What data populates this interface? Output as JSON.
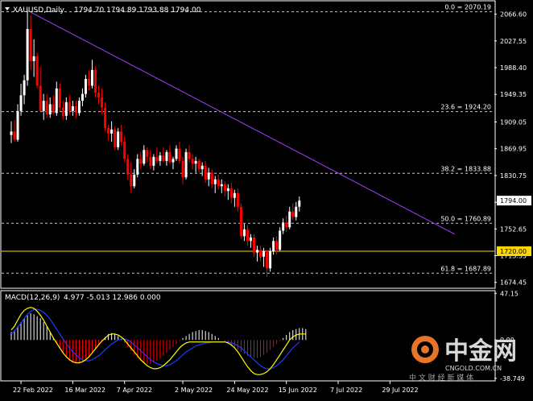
{
  "header": {
    "symbol": "XAUUSD,Daily",
    "ohlc": "1794.70 1794.89 1793.88 1794.00",
    "symbol_icon": "chevron-down-icon"
  },
  "macd_header": {
    "label": "MACD(12,26,9)",
    "values": "4.977 -5.013 12.986 0.000"
  },
  "watermark": {
    "logo_text": "中金网",
    "domain": "CNGOLD.COM.CN",
    "slogan": "中 文 财 经 新 媒 体",
    "logo_icon": "coin-icon"
  },
  "colors": {
    "background": "#000000",
    "bull": "#ffffff",
    "bear": "#ff0000",
    "trendline": "#a040ff",
    "fibo": "#c8c8c8",
    "support_line": "#ffd700",
    "macd_hist_pos": "#ffffff",
    "macd_hist_neg": "#ff0000",
    "macd_line": "#ffff00",
    "signal_line": "#1a3cff"
  },
  "chart_data": {
    "type": "candlestick",
    "symbol": "XAUUSD",
    "timeframe": "Daily",
    "price_ylim": [
      1667,
      2085
    ],
    "y_ticks": [
      "2066.60",
      "2027.55",
      "1988.40",
      "1949.35",
      "1909.05",
      "1869.95",
      "1830.75",
      "1791.65",
      "1752.65",
      "1713.55",
      "1674.45"
    ],
    "x_tick_labels": [
      "22 Feb 2022",
      "16 Mar 2022",
      "7 Apr 2022",
      "2 May 2022",
      "24 May 2022",
      "15 Jun 2022",
      "7 Jul 2022",
      "29 Jul 2022"
    ],
    "x_tick_index": [
      3,
      19,
      35,
      53,
      69,
      85,
      101,
      117
    ],
    "candles": [
      {
        "o": 1890,
        "h": 1910,
        "l": 1878,
        "c": 1895
      },
      {
        "o": 1895,
        "h": 1912,
        "l": 1880,
        "c": 1883
      },
      {
        "o": 1883,
        "h": 1935,
        "l": 1880,
        "c": 1925
      },
      {
        "o": 1925,
        "h": 1965,
        "l": 1918,
        "c": 1948
      },
      {
        "o": 1948,
        "h": 1978,
        "l": 1935,
        "c": 1970
      },
      {
        "o": 1970,
        "h": 2070,
        "l": 1962,
        "c": 2045
      },
      {
        "o": 2045,
        "h": 2065,
        "l": 1985,
        "c": 1998
      },
      {
        "o": 1998,
        "h": 2030,
        "l": 1975,
        "c": 2005
      },
      {
        "o": 2005,
        "h": 2010,
        "l": 1958,
        "c": 1962
      },
      {
        "o": 1962,
        "h": 1990,
        "l": 1938,
        "c": 1925
      },
      {
        "o": 1925,
        "h": 1950,
        "l": 1912,
        "c": 1940
      },
      {
        "o": 1940,
        "h": 1950,
        "l": 1915,
        "c": 1920
      },
      {
        "o": 1920,
        "h": 1945,
        "l": 1915,
        "c": 1935
      },
      {
        "o": 1935,
        "h": 1948,
        "l": 1920,
        "c": 1922
      },
      {
        "o": 1922,
        "h": 1968,
        "l": 1918,
        "c": 1958
      },
      {
        "o": 1958,
        "h": 1965,
        "l": 1925,
        "c": 1930
      },
      {
        "o": 1930,
        "h": 1940,
        "l": 1912,
        "c": 1918
      },
      {
        "o": 1918,
        "h": 1945,
        "l": 1912,
        "c": 1938
      },
      {
        "o": 1938,
        "h": 1948,
        "l": 1920,
        "c": 1925
      },
      {
        "o": 1925,
        "h": 1940,
        "l": 1918,
        "c": 1932
      },
      {
        "o": 1932,
        "h": 1940,
        "l": 1915,
        "c": 1922
      },
      {
        "o": 1922,
        "h": 1945,
        "l": 1918,
        "c": 1940
      },
      {
        "o": 1940,
        "h": 1958,
        "l": 1932,
        "c": 1950
      },
      {
        "o": 1950,
        "h": 1978,
        "l": 1945,
        "c": 1972
      },
      {
        "o": 1972,
        "h": 1985,
        "l": 1955,
        "c": 1962
      },
      {
        "o": 1962,
        "h": 2000,
        "l": 1958,
        "c": 1985
      },
      {
        "o": 1985,
        "h": 1990,
        "l": 1945,
        "c": 1952
      },
      {
        "o": 1952,
        "h": 1962,
        "l": 1935,
        "c": 1945
      },
      {
        "o": 1945,
        "h": 1958,
        "l": 1920,
        "c": 1930
      },
      {
        "o": 1930,
        "h": 1938,
        "l": 1895,
        "c": 1900
      },
      {
        "o": 1900,
        "h": 1905,
        "l": 1882,
        "c": 1892
      },
      {
        "o": 1892,
        "h": 1910,
        "l": 1880,
        "c": 1898
      },
      {
        "o": 1898,
        "h": 1902,
        "l": 1868,
        "c": 1872
      },
      {
        "o": 1872,
        "h": 1900,
        "l": 1868,
        "c": 1895
      },
      {
        "o": 1895,
        "h": 1905,
        "l": 1875,
        "c": 1880
      },
      {
        "o": 1880,
        "h": 1888,
        "l": 1850,
        "c": 1855
      },
      {
        "o": 1855,
        "h": 1862,
        "l": 1825,
        "c": 1832
      },
      {
        "o": 1832,
        "h": 1850,
        "l": 1805,
        "c": 1815
      },
      {
        "o": 1815,
        "h": 1840,
        "l": 1812,
        "c": 1832
      },
      {
        "o": 1832,
        "h": 1862,
        "l": 1828,
        "c": 1855
      },
      {
        "o": 1855,
        "h": 1865,
        "l": 1840,
        "c": 1848
      },
      {
        "o": 1848,
        "h": 1875,
        "l": 1845,
        "c": 1868
      },
      {
        "o": 1868,
        "h": 1872,
        "l": 1850,
        "c": 1858
      },
      {
        "o": 1858,
        "h": 1868,
        "l": 1840,
        "c": 1845
      },
      {
        "o": 1845,
        "h": 1862,
        "l": 1838,
        "c": 1858
      },
      {
        "o": 1858,
        "h": 1872,
        "l": 1848,
        "c": 1852
      },
      {
        "o": 1852,
        "h": 1865,
        "l": 1845,
        "c": 1860
      },
      {
        "o": 1860,
        "h": 1872,
        "l": 1850,
        "c": 1852
      },
      {
        "o": 1852,
        "h": 1868,
        "l": 1845,
        "c": 1865
      },
      {
        "o": 1865,
        "h": 1875,
        "l": 1848,
        "c": 1850
      },
      {
        "o": 1850,
        "h": 1858,
        "l": 1840,
        "c": 1855
      },
      {
        "o": 1855,
        "h": 1875,
        "l": 1852,
        "c": 1870
      },
      {
        "o": 1870,
        "h": 1880,
        "l": 1848,
        "c": 1852
      },
      {
        "o": 1852,
        "h": 1858,
        "l": 1818,
        "c": 1828
      },
      {
        "o": 1828,
        "h": 1870,
        "l": 1825,
        "c": 1865
      },
      {
        "o": 1865,
        "h": 1875,
        "l": 1850,
        "c": 1855
      },
      {
        "o": 1855,
        "h": 1862,
        "l": 1840,
        "c": 1848
      },
      {
        "o": 1848,
        "h": 1858,
        "l": 1835,
        "c": 1852
      },
      {
        "o": 1852,
        "h": 1855,
        "l": 1835,
        "c": 1840
      },
      {
        "o": 1840,
        "h": 1850,
        "l": 1830,
        "c": 1845
      },
      {
        "o": 1845,
        "h": 1852,
        "l": 1820,
        "c": 1825
      },
      {
        "o": 1825,
        "h": 1842,
        "l": 1815,
        "c": 1835
      },
      {
        "o": 1835,
        "h": 1840,
        "l": 1812,
        "c": 1818
      },
      {
        "o": 1818,
        "h": 1830,
        "l": 1805,
        "c": 1825
      },
      {
        "o": 1825,
        "h": 1832,
        "l": 1810,
        "c": 1815
      },
      {
        "o": 1815,
        "h": 1825,
        "l": 1805,
        "c": 1818
      },
      {
        "o": 1818,
        "h": 1822,
        "l": 1800,
        "c": 1808
      },
      {
        "o": 1808,
        "h": 1818,
        "l": 1795,
        "c": 1812
      },
      {
        "o": 1812,
        "h": 1820,
        "l": 1790,
        "c": 1798
      },
      {
        "o": 1798,
        "h": 1810,
        "l": 1785,
        "c": 1805
      },
      {
        "o": 1805,
        "h": 1812,
        "l": 1778,
        "c": 1785
      },
      {
        "o": 1785,
        "h": 1790,
        "l": 1738,
        "c": 1742
      },
      {
        "o": 1742,
        "h": 1760,
        "l": 1735,
        "c": 1752
      },
      {
        "o": 1752,
        "h": 1758,
        "l": 1728,
        "c": 1735
      },
      {
        "o": 1735,
        "h": 1745,
        "l": 1725,
        "c": 1740
      },
      {
        "o": 1740,
        "h": 1745,
        "l": 1712,
        "c": 1718
      },
      {
        "o": 1718,
        "h": 1728,
        "l": 1705,
        "c": 1722
      },
      {
        "o": 1722,
        "h": 1728,
        "l": 1705,
        "c": 1712
      },
      {
        "o": 1712,
        "h": 1725,
        "l": 1697,
        "c": 1720
      },
      {
        "o": 1720,
        "h": 1722,
        "l": 1682,
        "c": 1695
      },
      {
        "o": 1695,
        "h": 1725,
        "l": 1690,
        "c": 1720
      },
      {
        "o": 1720,
        "h": 1740,
        "l": 1715,
        "c": 1735
      },
      {
        "o": 1735,
        "h": 1742,
        "l": 1715,
        "c": 1722
      },
      {
        "o": 1722,
        "h": 1755,
        "l": 1720,
        "c": 1750
      },
      {
        "o": 1750,
        "h": 1768,
        "l": 1745,
        "c": 1762
      },
      {
        "o": 1762,
        "h": 1772,
        "l": 1748,
        "c": 1755
      },
      {
        "o": 1755,
        "h": 1785,
        "l": 1752,
        "c": 1778
      },
      {
        "o": 1778,
        "h": 1790,
        "l": 1765,
        "c": 1770
      },
      {
        "o": 1770,
        "h": 1792,
        "l": 1765,
        "c": 1785
      },
      {
        "o": 1785,
        "h": 1800,
        "l": 1778,
        "c": 1794
      }
    ],
    "candle_index_offset": 0,
    "fibonacci": {
      "levels": [
        {
          "label": "0.0 = 2070.19",
          "price": 2070.19
        },
        {
          "label": "23.6 = 1924.20",
          "price": 1924.2
        },
        {
          "label": "38.2 = 1833.88",
          "price": 1833.88
        },
        {
          "label": "50.0 = 1760.89",
          "price": 1760.89
        },
        {
          "label": "61.8 = 1687.89",
          "price": 1687.89
        }
      ]
    },
    "current_price_label": "1794.00",
    "support_level": {
      "label": "1720.00",
      "price": 1720.0
    },
    "trendline": {
      "start": {
        "index": 5,
        "price": 2072
      },
      "end": {
        "index": 137,
        "price": 1745
      }
    },
    "macd": {
      "ylim": [
        -40.5,
        49
      ],
      "y_ticks": [
        "47.15",
        "0.00",
        "-38.749"
      ],
      "histogram": [
        8,
        10,
        14,
        18,
        22,
        25,
        27,
        26,
        24,
        22,
        18,
        14,
        8,
        2,
        -4,
        -9,
        -14,
        -18,
        -21,
        -23,
        -24,
        -24,
        -22,
        -20,
        -17,
        -13,
        -9,
        -5,
        -1,
        3,
        6,
        7,
        6,
        4,
        1,
        -3,
        -7,
        -11,
        -15,
        -18,
        -21,
        -23,
        -24,
        -24,
        -23,
        -21,
        -19,
        -16,
        -13,
        -10,
        -7,
        -4,
        -1,
        2,
        4,
        6,
        8,
        9,
        10,
        10,
        9,
        8,
        6,
        4,
        2,
        0,
        -2,
        -4,
        -6,
        -8,
        -10,
        -12,
        -14,
        -16,
        -17,
        -18,
        -18,
        -17,
        -15,
        -13,
        -10,
        -7,
        -4,
        -1,
        2,
        5,
        8,
        10,
        11,
        12,
        12,
        11
      ],
      "macd_line": [
        10,
        14,
        20,
        26,
        30,
        32,
        33,
        32,
        29,
        25,
        20,
        14,
        8,
        2,
        -3,
        -8,
        -13,
        -17,
        -20,
        -22,
        -23,
        -23,
        -22,
        -20,
        -17,
        -13,
        -9,
        -5,
        -1,
        2,
        5,
        6,
        6,
        5,
        3,
        0,
        -4,
        -8,
        -12,
        -16,
        -20,
        -23,
        -26,
        -28,
        -29,
        -29,
        -28,
        -26,
        -23,
        -20,
        -16,
        -12,
        -8,
        -5,
        -3,
        -2,
        -2,
        -2,
        -2,
        -2,
        -2,
        -2,
        -2,
        -2,
        -2,
        -2,
        -2,
        -3,
        -5,
        -8,
        -12,
        -17,
        -22,
        -27,
        -31,
        -34,
        -35,
        -35,
        -34,
        -32,
        -29,
        -25,
        -20,
        -15,
        -10,
        -5,
        0,
        3,
        5,
        6,
        6,
        6
      ],
      "signal_line": [
        6,
        9,
        13,
        17,
        22,
        26,
        29,
        31,
        31,
        30,
        28,
        25,
        21,
        16,
        11,
        6,
        1,
        -4,
        -8,
        -12,
        -15,
        -18,
        -20,
        -21,
        -21,
        -20,
        -18,
        -16,
        -13,
        -10,
        -7,
        -4,
        -2,
        0,
        1,
        1,
        0,
        -2,
        -5,
        -8,
        -11,
        -14,
        -17,
        -20,
        -22,
        -24,
        -25,
        -26,
        -26,
        -25,
        -23,
        -21,
        -18,
        -15,
        -12,
        -10,
        -8,
        -6,
        -5,
        -4,
        -3,
        -3,
        -2,
        -2,
        -2,
        -2,
        -2,
        -2,
        -3,
        -4,
        -6,
        -8,
        -11,
        -14,
        -17,
        -20,
        -23,
        -26,
        -28,
        -29,
        -29,
        -28,
        -26,
        -23,
        -20,
        -16,
        -12,
        -8,
        -5,
        -2
      ]
    }
  }
}
